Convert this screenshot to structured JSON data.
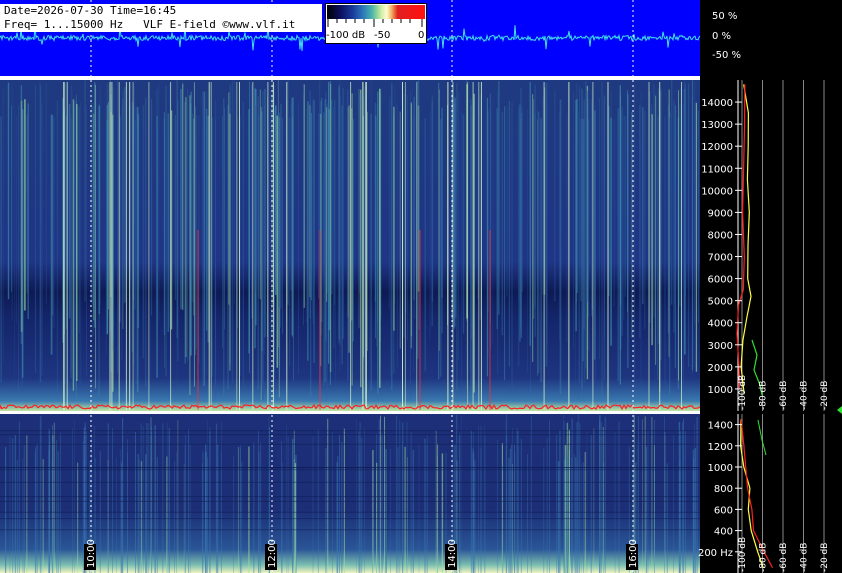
{
  "header": {
    "line1": "Date=2026-07-30 Time=16:45",
    "line2": "Freq= 1...15000 Hz   VLF E-field ©www.vlf.it"
  },
  "colorbar": {
    "labels": [
      "-100 dB",
      "-50",
      "0"
    ]
  },
  "waveform": {
    "labels": [
      "50 %",
      "0 %",
      "-50 %"
    ]
  },
  "colors": {
    "waveform_bg": "#0000ff",
    "waveform_trace": "#40e0e8",
    "spectrum_bg": "#1a2a78",
    "yellow_trace": "#ffff40",
    "red_trace": "#ff2020",
    "green_trace": "#30e030"
  },
  "chart_data": [
    {
      "type": "heatmap",
      "title": "",
      "xlabel": "",
      "ylabel": "",
      "x_ticks": [
        "10:00",
        "12:00",
        "14:00",
        "16:00"
      ],
      "y_ticks": [
        "1000",
        "2000",
        "3000",
        "4000",
        "5000",
        "6000",
        "7000",
        "8000",
        "9000",
        "10000",
        "11000",
        "12000",
        "13000",
        "14000"
      ],
      "ylim": [
        0,
        15000
      ],
      "grid": true
    },
    {
      "type": "heatmap",
      "title": "",
      "xlabel": "",
      "ylabel": "",
      "x_ticks": [
        "10:00",
        "12:00",
        "14:00",
        "16:00"
      ],
      "y_ticks": [
        "200 Hz",
        "400",
        "600",
        "800",
        "1000",
        "1200",
        "1400"
      ],
      "ylim": [
        0,
        1500
      ],
      "grid": true
    },
    {
      "type": "line",
      "title": "",
      "x_ticks": [
        "-100 dB",
        "-80 dB",
        "-60 dB",
        "-40 dB",
        "-20 dB"
      ],
      "series": [
        {
          "color": "#ffff40",
          "points": [
            [
              -97,
              14800
            ],
            [
              -95,
              13500
            ],
            [
              -94,
              12000
            ],
            [
              -95,
              10500
            ],
            [
              -94,
              9000
            ],
            [
              -93,
              7500
            ],
            [
              -93,
              6000
            ],
            [
              -92,
              5200
            ],
            [
              -96,
              4200
            ],
            [
              -98,
              3200
            ],
            [
              -100,
              2000
            ],
            [
              -98,
              800
            ]
          ]
        },
        {
          "color": "#ff2020",
          "points": [
            [
              -98,
              14800
            ],
            [
              -98,
              13000
            ],
            [
              -98,
              11000
            ],
            [
              -98,
              9000
            ],
            [
              -99,
              7000
            ],
            [
              -98,
              5500
            ],
            [
              -103,
              4800
            ],
            [
              -104,
              3500
            ],
            [
              -103,
              2000
            ],
            [
              -103,
              1000
            ]
          ]
        }
      ]
    },
    {
      "type": "line",
      "title": "",
      "x_ticks": [
        "-100 dB",
        "-80 dB",
        "-60 dB",
        "-40 dB",
        "-20 dB"
      ],
      "series": [
        {
          "color": "#ffff40",
          "points": [
            [
              -100,
              1450
            ],
            [
              -102,
              1200
            ],
            [
              -97,
              1000
            ],
            [
              -94,
              800
            ],
            [
              -92,
              600
            ],
            [
              -90,
              400
            ],
            [
              -85,
              200
            ],
            [
              -78,
              50
            ]
          ]
        },
        {
          "color": "#ff2020",
          "points": [
            [
              -101,
              1450
            ],
            [
              -99,
              1200
            ],
            [
              -96,
              1000
            ],
            [
              -93,
              800
            ],
            [
              -91,
              600
            ],
            [
              -88,
              400
            ],
            [
              -80,
              200
            ],
            [
              -72,
              50
            ]
          ]
        }
      ]
    }
  ]
}
